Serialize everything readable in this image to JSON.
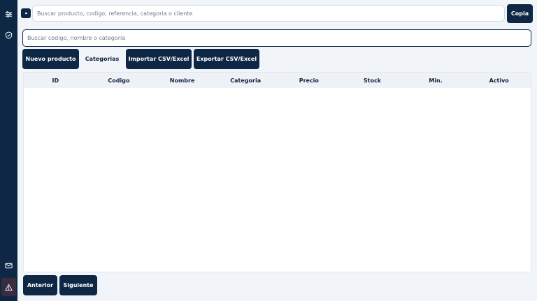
{
  "sidebar": {
    "icons": [
      "sliders-icon",
      "shield-check-icon",
      "mail-icon",
      "alert-triangle-icon"
    ]
  },
  "search": {
    "placeholder": "Buscar producto, codigo, referencia, categoria o cliente"
  },
  "copy_label": "Copia",
  "filter": {
    "placeholder": "Buscar codigo, nombre o categoria"
  },
  "toolbar": {
    "new_product": "Nuevo producto",
    "categories": "Categorias",
    "import": "Importar CSV/Excel",
    "export": "Exportar CSV/Excel"
  },
  "table": {
    "columns": [
      "ID",
      "Codigo",
      "Nombre",
      "Categoria",
      "Precio",
      "Stock",
      "Min.",
      "Activo"
    ],
    "rows": []
  },
  "pagination": {
    "prev": "Anterior",
    "next": "Siguiente"
  },
  "colors": {
    "primary": "#0d2744",
    "background": "#f1f4f9",
    "table_header": "#eef2f7"
  }
}
